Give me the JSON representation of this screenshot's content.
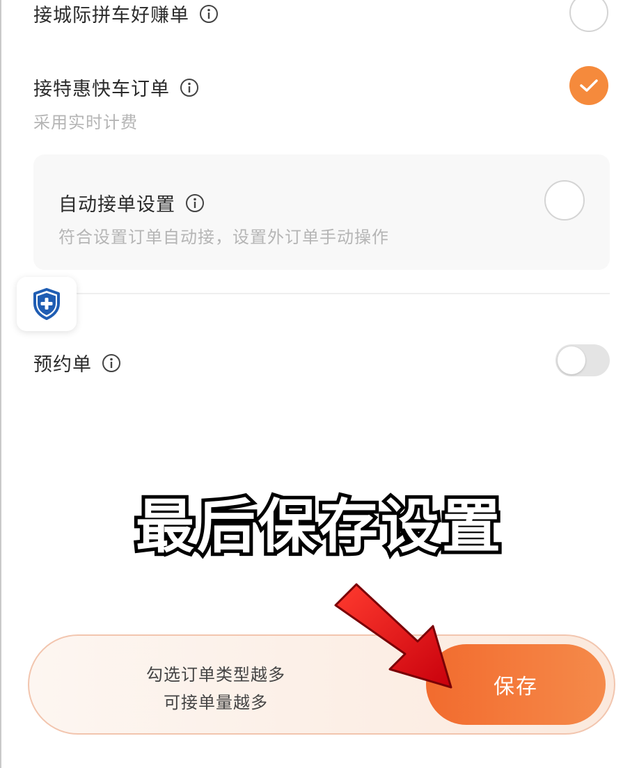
{
  "rows": {
    "intercity": {
      "label": "接城际拼车好赚单"
    },
    "discount": {
      "label": "接特惠快车订单",
      "subtext": "采用实时计费"
    },
    "auto_accept": {
      "label": "自动接单设置",
      "subtext": "符合设置订单自动接，设置外订单手动操作"
    },
    "reservation": {
      "label": "预约单"
    }
  },
  "overlay": {
    "caption": "最后保存设置"
  },
  "bottom": {
    "hint_line1": "勾选订单类型越多",
    "hint_line2": "可接单量越多",
    "save_label": "保存"
  },
  "state": {
    "intercity_checked": false,
    "discount_checked": true,
    "auto_accept_checked": false,
    "reservation_enabled": false
  },
  "colors": {
    "accent": "#f58a3c",
    "save_button": "#f26b2e",
    "arrow": "#e8111a",
    "shield": "#1f5db3"
  },
  "icons": [
    "info-icon",
    "check-icon",
    "shield-plus-icon",
    "arrow-icon"
  ]
}
